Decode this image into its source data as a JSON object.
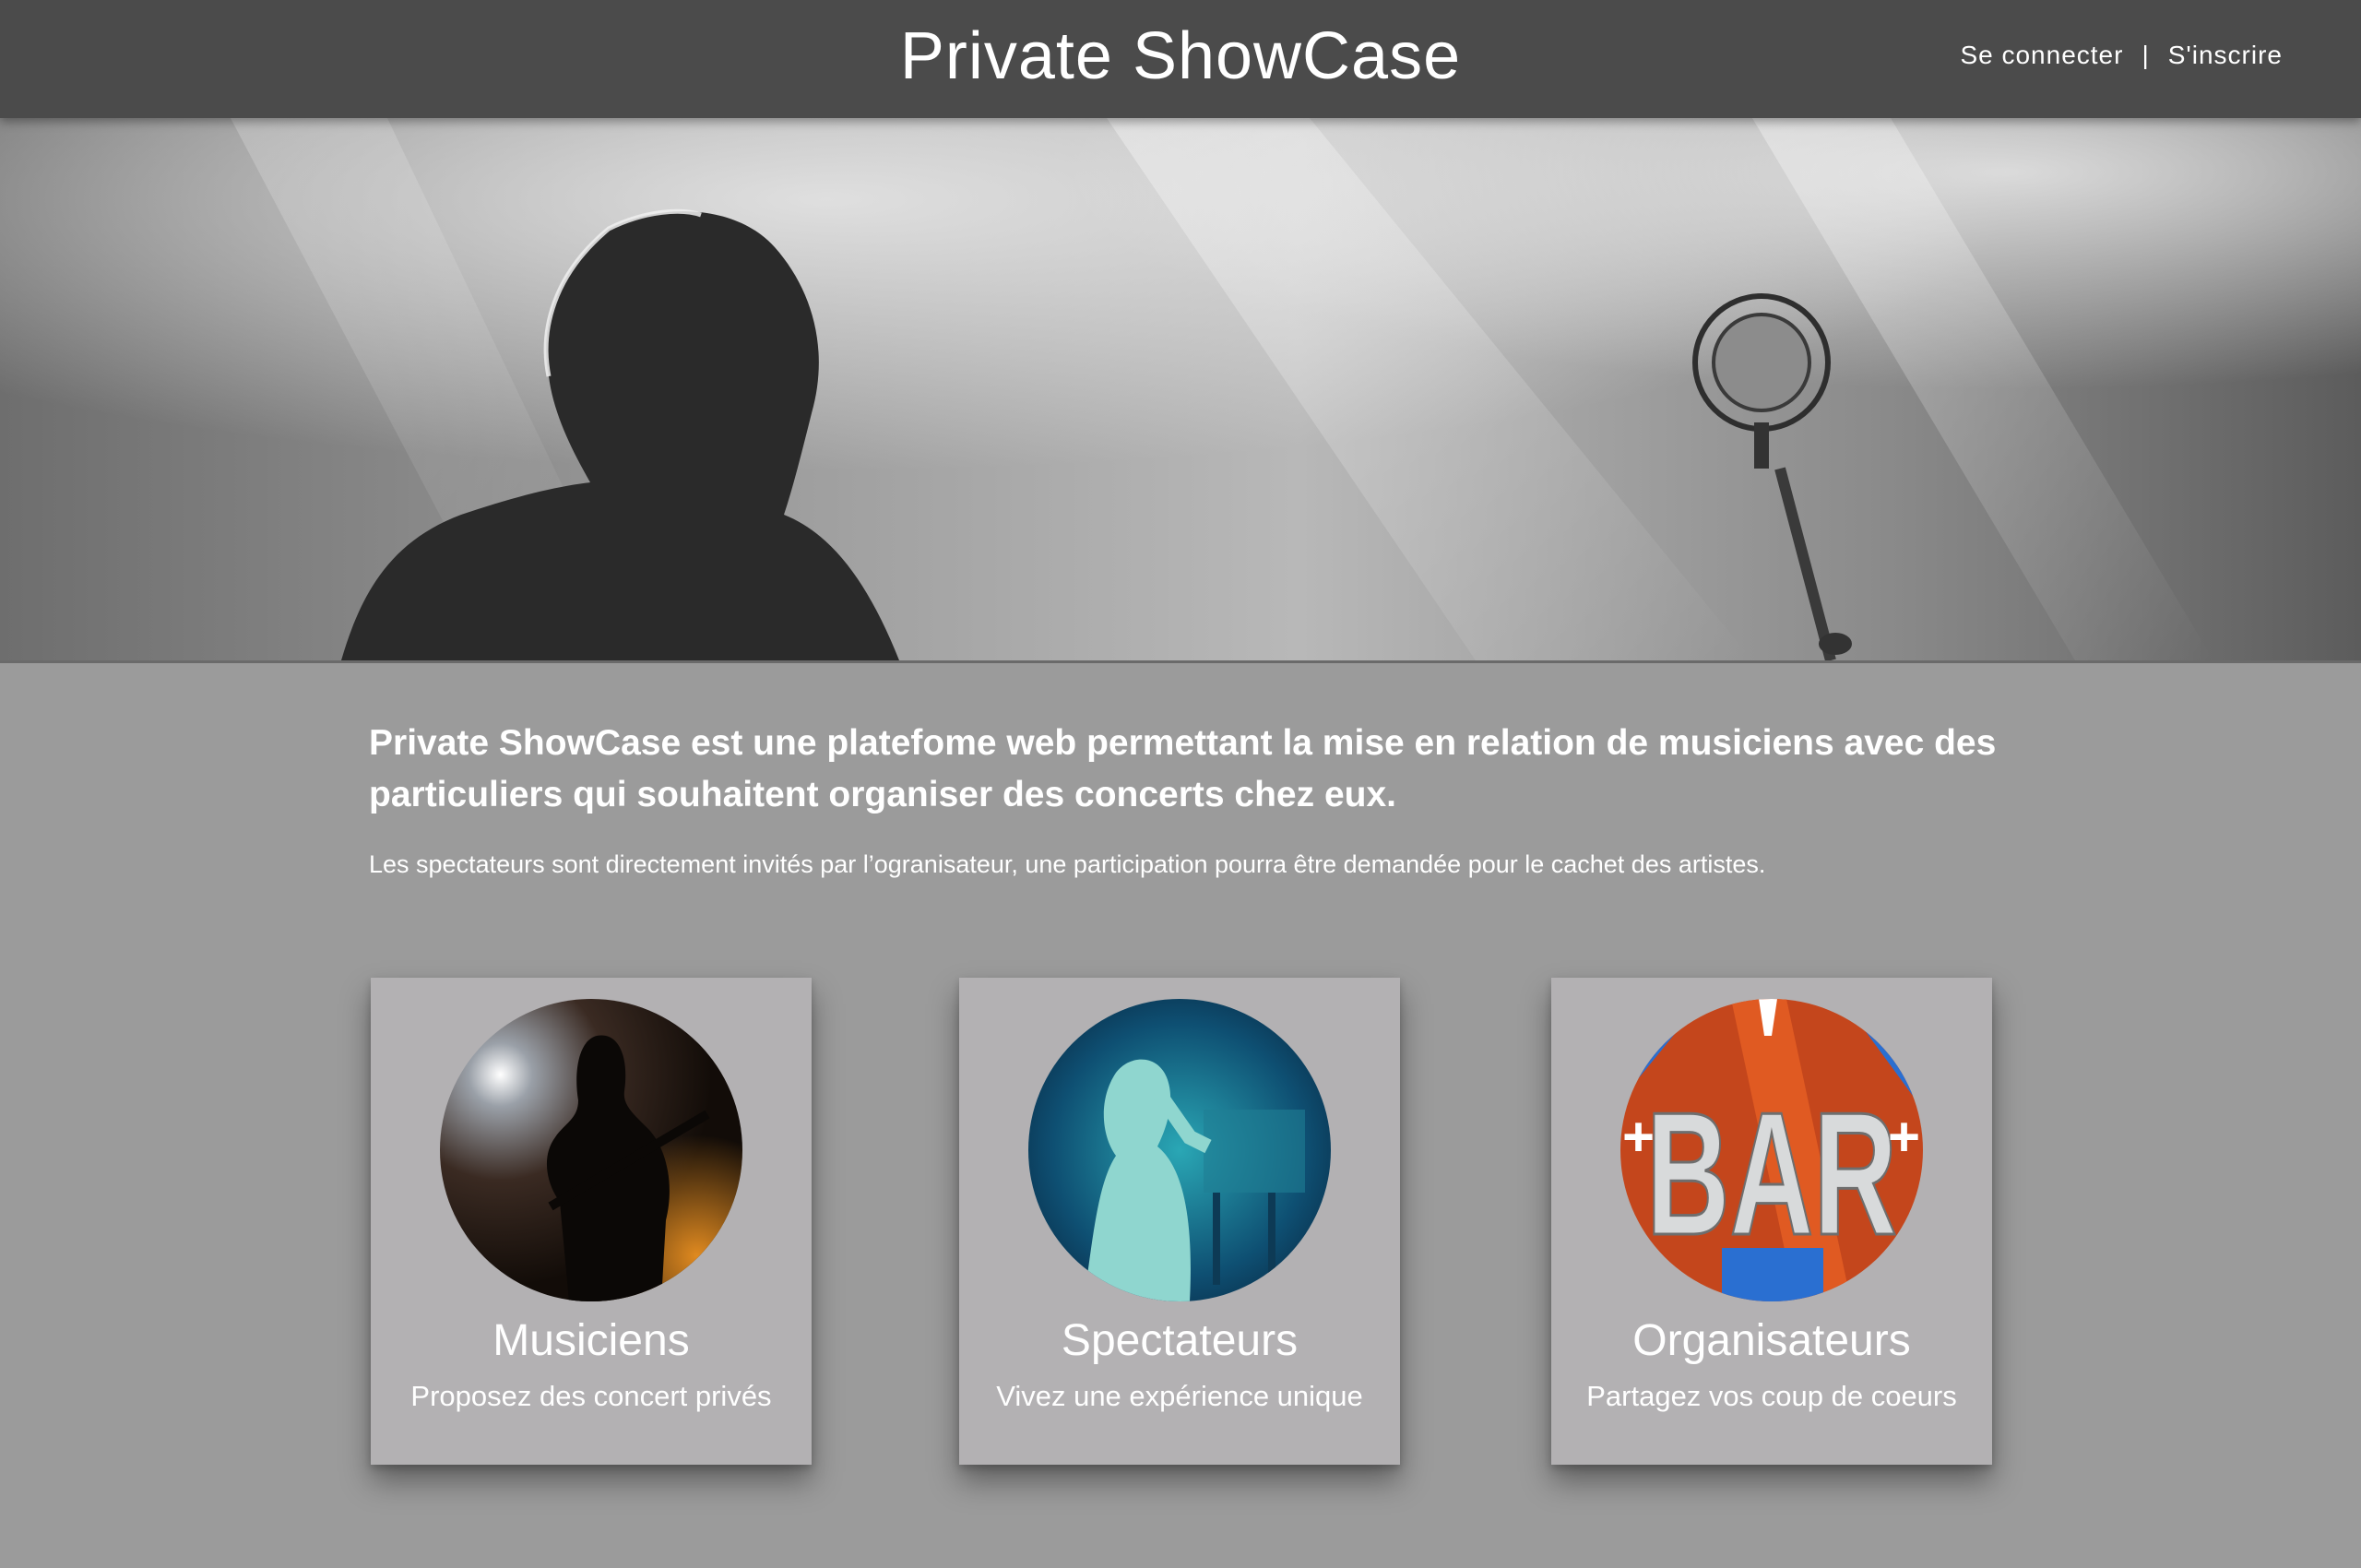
{
  "header": {
    "title": "Private ShowCase",
    "login_label": "Se connecter",
    "separator": "|",
    "signup_label": "S'inscrire",
    "background_color": "#4b4b4b"
  },
  "hero": {
    "image": "black-and-white photo of singer with microphone stand under stage lights"
  },
  "intro": {
    "headline": "Private ShowCase est une platefome web permettant la mise en relation de musiciens avec des particuliers qui souhaitent organiser des concerts chez eux.",
    "subtext": "Les spectateurs sont directement invités par l’ogranisateur, une participation pourra être demandée pour le cachet des artistes."
  },
  "cards": [
    {
      "title": "Musiciens",
      "description": "Proposez des concert privés",
      "image": "guitarist silhouette on stage"
    },
    {
      "title": "Spectateurs",
      "description": "Vivez une expérience unique",
      "image": "performer under blue stage light"
    },
    {
      "title": "Organisateurs",
      "description": "Partagez vos coup de coeurs",
      "image": "BAR sign"
    }
  ],
  "colors": {
    "page_background": "#9b9b9b",
    "card_background": "#b3b1b3",
    "text": "#ffffff"
  }
}
